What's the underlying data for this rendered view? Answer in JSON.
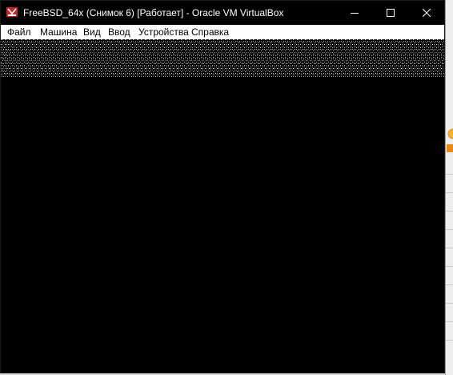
{
  "window": {
    "title": "FreeBSD_64x (Снимок 6) [Работает] - Oracle VM VirtualBox",
    "app_icon": "virtualbox-icon",
    "controls": [
      "minimize-icon",
      "maximize-icon",
      "close-icon"
    ]
  },
  "menu": {
    "items": [
      "Файл",
      "Машина",
      "Вид",
      "Ввод",
      "Устройства",
      "Справка"
    ]
  },
  "vm_screen": {
    "state": "garbled text-mode output at top, rest black"
  },
  "colors": {
    "titlebar_bg": "#000000",
    "title_text": "#ffffff",
    "menubar_bg": "#ffffff",
    "vm_screen_bg": "#000000",
    "app_icon_accent": "#c0272d"
  }
}
